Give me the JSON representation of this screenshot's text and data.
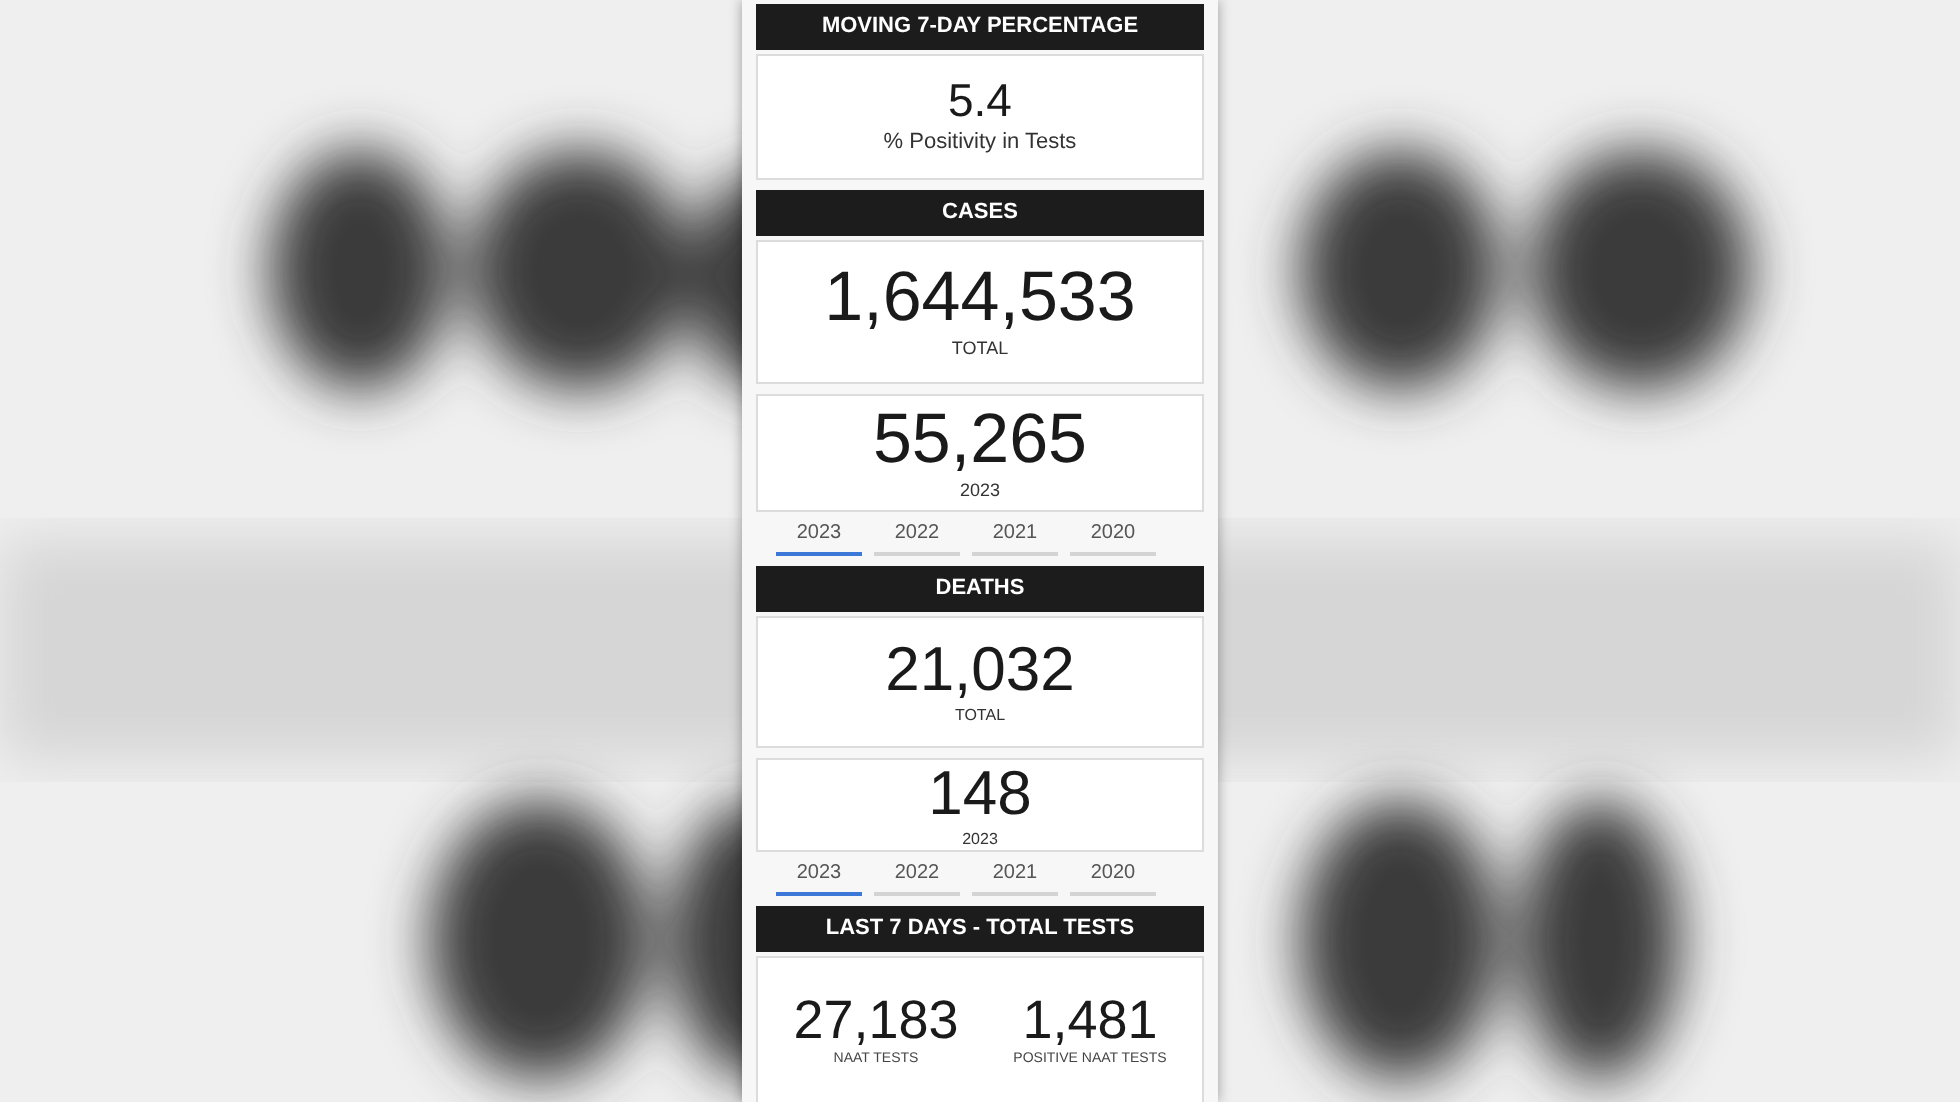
{
  "sections": [
    {
      "kind": "header",
      "title": "MOVING 7-DAY PERCENTAGE"
    },
    {
      "kind": "stat",
      "value": "5.4",
      "label": "% Positivity in Tests"
    },
    {
      "kind": "header",
      "title": "CASES"
    },
    {
      "kind": "stat",
      "value": "1,644,533",
      "label": "TOTAL"
    },
    {
      "kind": "yearly",
      "value": "55,265",
      "label": "2023",
      "tabs": [
        {
          "label": "2023",
          "selected": true
        },
        {
          "label": "2022",
          "selected": false
        },
        {
          "label": "2021",
          "selected": false
        },
        {
          "label": "2020",
          "selected": false
        }
      ]
    },
    {
      "kind": "header",
      "title": "DEATHS"
    },
    {
      "kind": "stat",
      "value": "21,032",
      "label": "TOTAL"
    },
    {
      "kind": "yearly",
      "value": "148",
      "label": "2023",
      "tabs": [
        {
          "label": "2023",
          "selected": true
        },
        {
          "label": "2022",
          "selected": false
        },
        {
          "label": "2021",
          "selected": false
        },
        {
          "label": "2020",
          "selected": false
        }
      ]
    },
    {
      "kind": "header",
      "title": "LAST 7 DAYS - TOTAL TESTS"
    },
    {
      "kind": "pair",
      "items": [
        {
          "value": "27,183",
          "label": "NAAT TESTS"
        },
        {
          "value": "1,481",
          "label": "POSITIVE NAAT TESTS"
        }
      ]
    }
  ]
}
